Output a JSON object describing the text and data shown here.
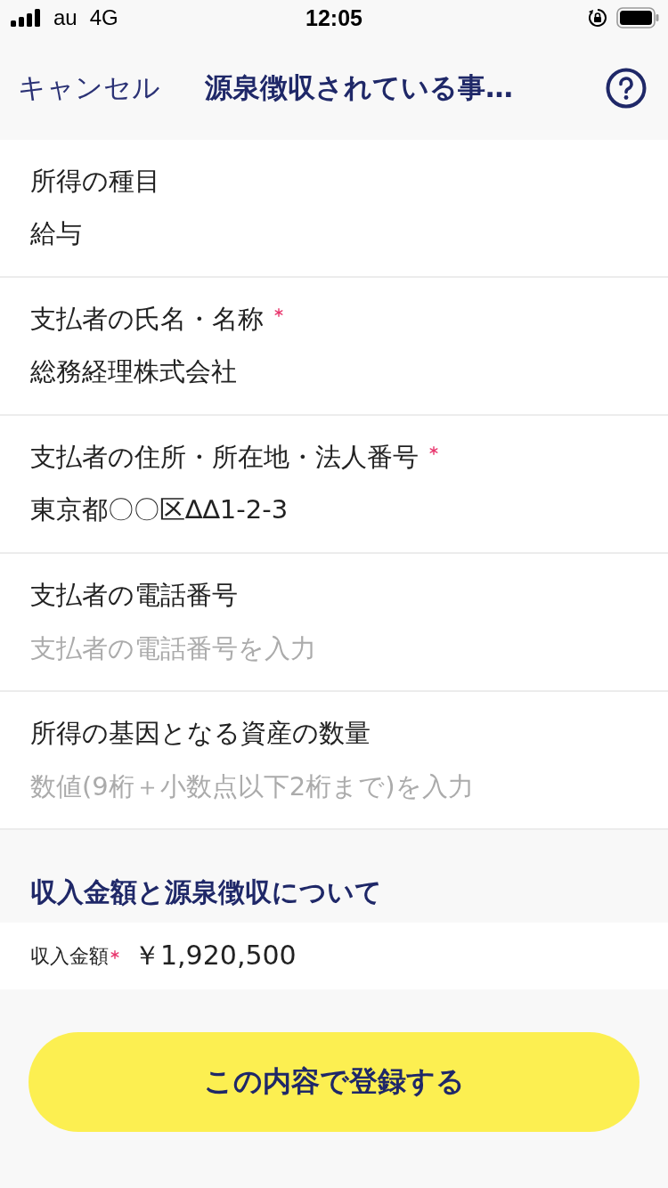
{
  "status_bar": {
    "carrier": "au",
    "network": "4G",
    "time": "12:05"
  },
  "nav": {
    "cancel": "キャンセル",
    "title": "源泉徴収されている事…"
  },
  "fields": [
    {
      "label": "所得の種目",
      "required": false,
      "value": "給与"
    },
    {
      "label": "支払者の氏名・名称",
      "required": true,
      "value": "総務経理株式会社"
    },
    {
      "label": "支払者の住所・所在地・法人番号",
      "required": true,
      "value": "東京都〇〇区∆∆1-2-3"
    },
    {
      "label": "支払者の電話番号",
      "required": false,
      "placeholder": "支払者の電話番号を入力"
    },
    {
      "label": "所得の基因となる資産の数量",
      "required": false,
      "placeholder": "数値(9桁＋小数点以下2桁まで)を入力"
    }
  ],
  "section": {
    "title": "収入金額と源泉徴収について",
    "amount": {
      "label": "収入金額",
      "required": true,
      "value": "￥1,920,500"
    }
  },
  "submit": "この内容で登録する"
}
